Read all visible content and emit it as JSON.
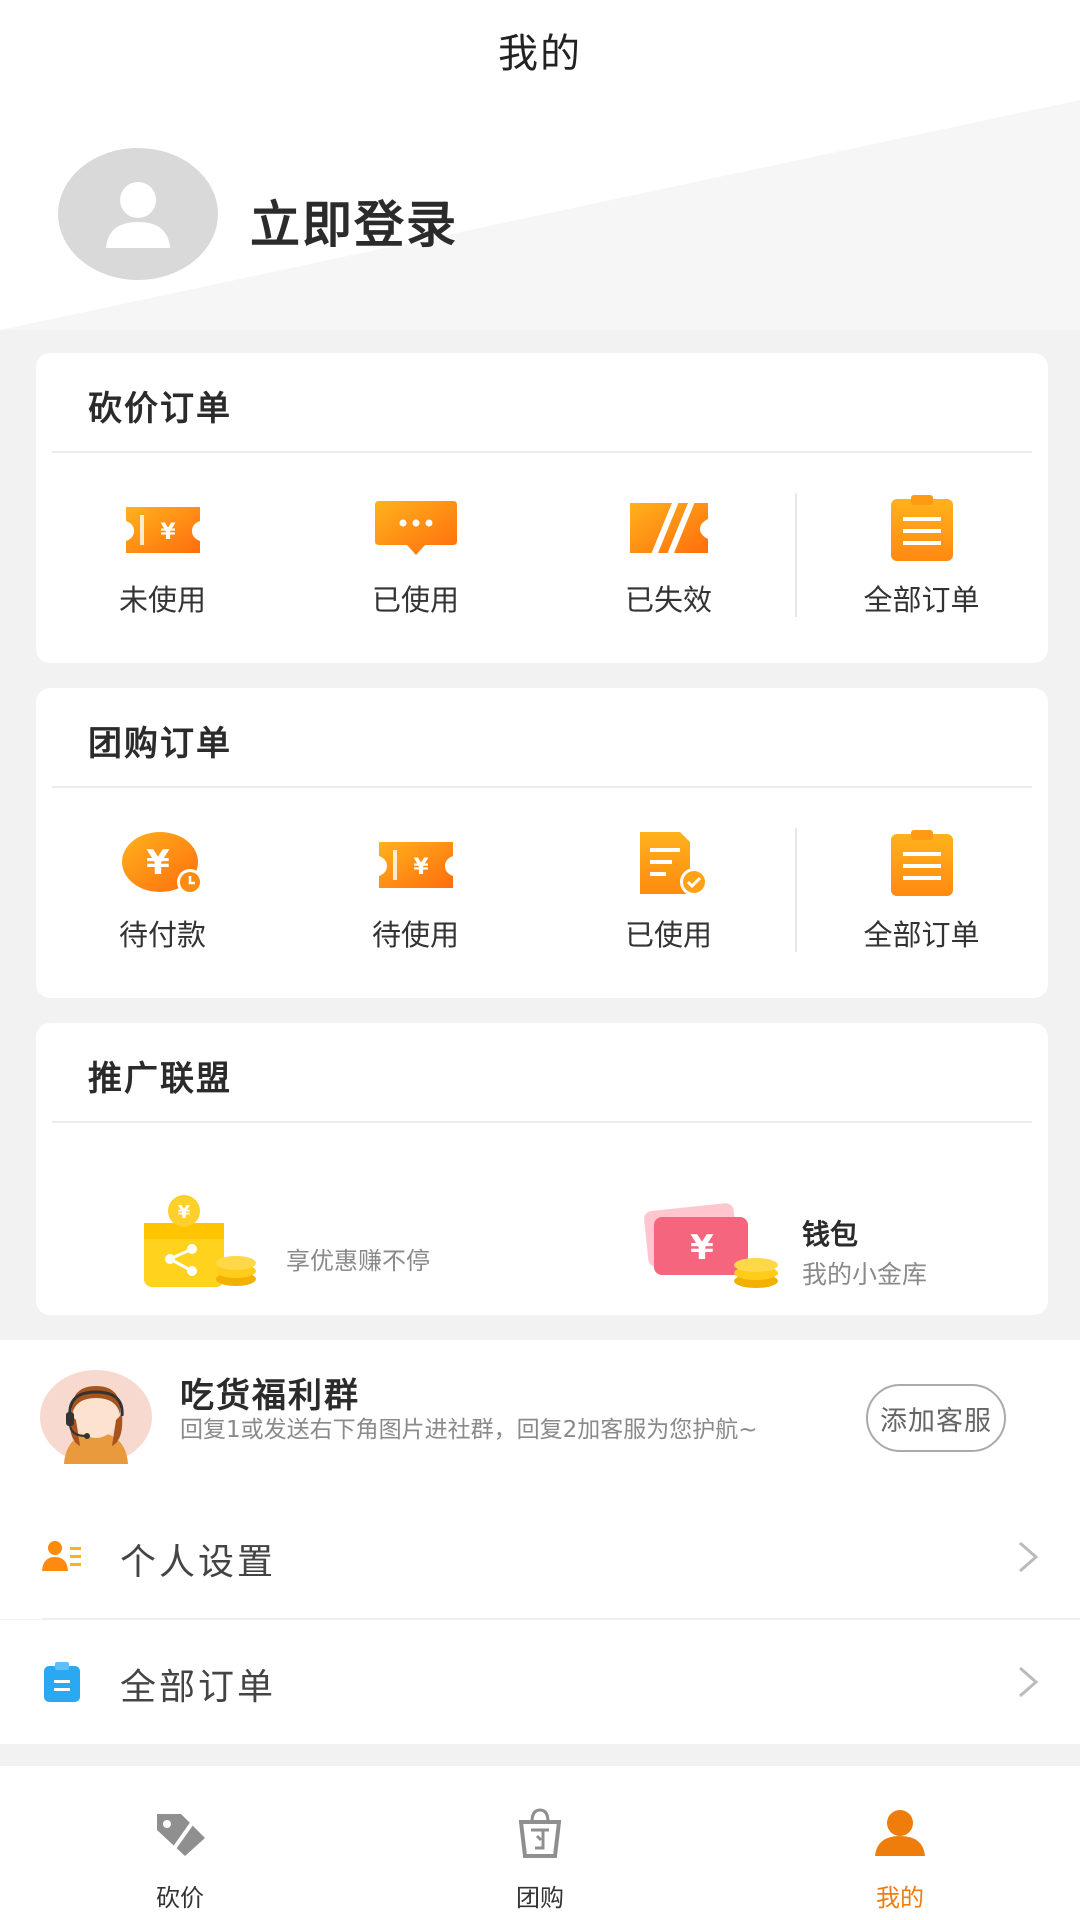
{
  "header": {
    "title": "我的"
  },
  "profile": {
    "login_label": "立即登录"
  },
  "bargain_orders": {
    "title": "砍价订单",
    "items": [
      {
        "label": "未使用",
        "icon": "ticket-icon"
      },
      {
        "label": "已使用",
        "icon": "message-icon"
      },
      {
        "label": "已失效",
        "icon": "expired-ticket-icon"
      },
      {
        "label": "全部订单",
        "icon": "clipboard-icon"
      }
    ]
  },
  "group_orders": {
    "title": "团购订单",
    "items": [
      {
        "label": "待付款",
        "icon": "yen-clock-icon"
      },
      {
        "label": "待使用",
        "icon": "ticket-icon"
      },
      {
        "label": "已使用",
        "icon": "clipboard-check-icon"
      },
      {
        "label": "全部订单",
        "icon": "clipboard-icon"
      }
    ]
  },
  "promotion": {
    "title": "推广联盟",
    "share_text": "享优惠赚不停",
    "wallet_title": "钱包",
    "wallet_subtitle": "我的小金库"
  },
  "group_chat": {
    "title": "吃货福利群",
    "description": "回复1或发送右下角图片进社群，回复2加客服为您护航~",
    "button": "添加客服"
  },
  "menu": [
    {
      "label": "个人设置",
      "icon": "user-settings-icon"
    },
    {
      "label": "全部订单",
      "icon": "order-list-icon"
    }
  ],
  "tabbar": [
    {
      "label": "砍价",
      "icon": "tag-icon",
      "active": false
    },
    {
      "label": "团购",
      "icon": "bag-icon",
      "active": false
    },
    {
      "label": "我的",
      "icon": "user-icon",
      "active": true
    }
  ],
  "colors": {
    "accent": "#ef7d0b",
    "orange_gradient_start": "#ffb21c",
    "orange_gradient_end": "#ff6d0d"
  }
}
